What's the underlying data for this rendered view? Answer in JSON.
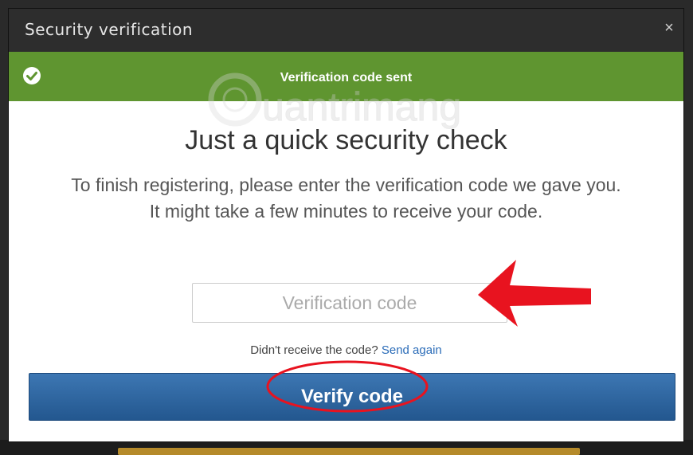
{
  "dialog": {
    "title": "Security verification",
    "close_label": "×"
  },
  "banner": {
    "message": "Verification code sent",
    "color": "#5f9530"
  },
  "watermark": {
    "text": "uantrimang"
  },
  "content": {
    "heading": "Just a quick security check",
    "instruction_line1": "To finish registering, please enter the verification code we gave you.",
    "instruction_line2": "It might take a few minutes to receive your code."
  },
  "code_input": {
    "placeholder": "Verification code",
    "value": ""
  },
  "resend": {
    "prompt": "Didn't receive the code?",
    "link_label": "Send again"
  },
  "verify_button": {
    "label": "Verify code",
    "color": "#2d65a1"
  },
  "annotation": {
    "color": "#e8131f"
  }
}
